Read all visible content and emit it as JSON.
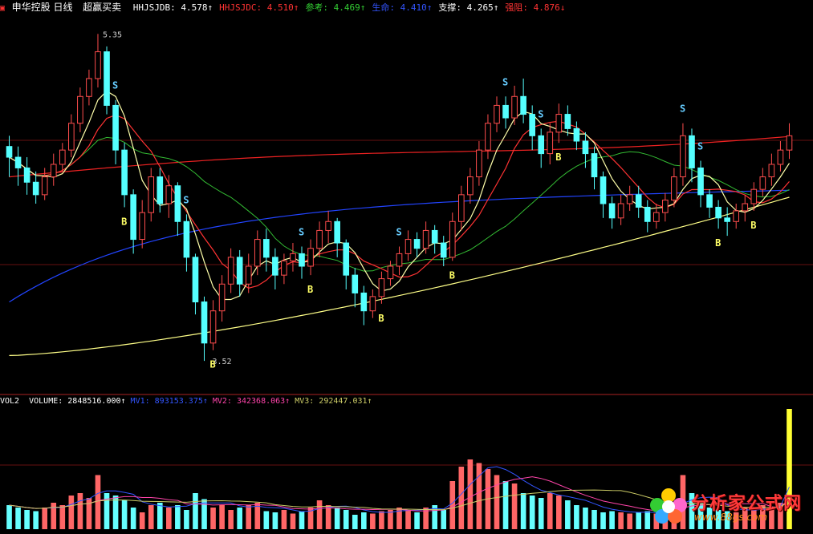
{
  "header": {
    "title": "申华控股 日线",
    "indicator_name": "超赢买卖",
    "items": [
      {
        "label": "HHJSJDB",
        "value": "4.578",
        "arrow": "↑",
        "color": "#ffffff"
      },
      {
        "label": "HHJSJDC",
        "value": "4.510",
        "arrow": "↑",
        "color": "#ff3333"
      },
      {
        "label": "参考",
        "value": "4.469",
        "arrow": "↑",
        "color": "#33cc33"
      },
      {
        "label": "生命",
        "value": "4.410",
        "arrow": "↑",
        "color": "#3355ff"
      },
      {
        "label": "支撑",
        "value": "4.265",
        "arrow": "↑",
        "color": "#ffffff"
      },
      {
        "label": "强阻",
        "value": "4.876",
        "arrow": "↓",
        "color": "#ff3333"
      }
    ]
  },
  "volume_header": {
    "name": "VOL2",
    "items": [
      {
        "label": "VOLUME",
        "value": "2848516.000",
        "arrow": "↑",
        "color": "#ffffff"
      },
      {
        "label": "MV1",
        "value": "893153.375",
        "arrow": "↑",
        "color": "#3355ff"
      },
      {
        "label": "MV2",
        "value": "342368.063",
        "arrow": "↑",
        "color": "#ff44aa"
      },
      {
        "label": "MV3",
        "value": "292447.031",
        "arrow": "↑",
        "color": "#cccc66"
      }
    ]
  },
  "chart_data": {
    "type": "candlestick",
    "price_labels": {
      "high": "5.35",
      "low": "3.52"
    },
    "signal_labels": {
      "buy": "B",
      "sell": "S"
    },
    "series_colors": {
      "up": "#ff4d4d",
      "down": "#55ffff",
      "ma_short": "#ffffaa",
      "ma_mid": "#ff3333",
      "ma_green": "#33bb33",
      "ma_blue": "#2244ff",
      "ma_yellow": "#ffff88",
      "ma_red_long": "#ee2222"
    },
    "legend_watermark": {
      "text": "分析家公式网",
      "url": "www.88gs.com"
    },
    "candles": [
      [
        4.72,
        4.66,
        4.78,
        4.55
      ],
      [
        4.66,
        4.6,
        4.72,
        4.5
      ],
      [
        4.6,
        4.52,
        4.66,
        4.45
      ],
      [
        4.52,
        4.45,
        4.58,
        4.4
      ],
      [
        4.45,
        4.55,
        4.6,
        4.42
      ],
      [
        4.55,
        4.62,
        4.68,
        4.5
      ],
      [
        4.62,
        4.7,
        4.74,
        4.58
      ],
      [
        4.7,
        4.85,
        4.9,
        4.66
      ],
      [
        4.85,
        5.0,
        5.05,
        4.8
      ],
      [
        5.0,
        5.1,
        5.15,
        4.95
      ],
      [
        5.1,
        5.25,
        5.35,
        5.05
      ],
      [
        5.25,
        4.95,
        5.28,
        4.9
      ],
      [
        4.95,
        4.7,
        4.98,
        4.62
      ],
      [
        4.7,
        4.45,
        4.74,
        4.38
      ],
      [
        4.45,
        4.2,
        4.48,
        4.12
      ],
      [
        4.2,
        4.35,
        4.42,
        4.15
      ],
      [
        4.35,
        4.55,
        4.6,
        4.3
      ],
      [
        4.55,
        4.4,
        4.6,
        4.35
      ],
      [
        4.4,
        4.5,
        4.56,
        4.32
      ],
      [
        4.5,
        4.3,
        4.52,
        4.22
      ],
      [
        4.3,
        4.1,
        4.34,
        4.02
      ],
      [
        4.1,
        3.85,
        4.12,
        3.78
      ],
      [
        3.85,
        3.62,
        3.88,
        3.52
      ],
      [
        3.62,
        3.8,
        3.86,
        3.58
      ],
      [
        3.8,
        3.95,
        4.0,
        3.74
      ],
      [
        3.95,
        4.1,
        4.15,
        3.9
      ],
      [
        4.1,
        3.95,
        4.14,
        3.88
      ],
      [
        3.95,
        4.05,
        4.12,
        3.9
      ],
      [
        4.05,
        4.2,
        4.25,
        4.0
      ],
      [
        4.2,
        4.1,
        4.26,
        4.02
      ],
      [
        4.1,
        4.0,
        4.15,
        3.92
      ],
      [
        4.0,
        4.08,
        4.12,
        3.95
      ],
      [
        4.08,
        4.12,
        4.18,
        4.02
      ],
      [
        4.12,
        4.05,
        4.16,
        3.98
      ],
      [
        4.05,
        4.15,
        4.2,
        4.0
      ],
      [
        4.15,
        4.25,
        4.3,
        4.1
      ],
      [
        4.25,
        4.3,
        4.36,
        4.18
      ],
      [
        4.3,
        4.18,
        4.32,
        4.1
      ],
      [
        4.18,
        4.0,
        4.2,
        3.92
      ],
      [
        4.0,
        3.9,
        4.04,
        3.82
      ],
      [
        3.9,
        3.8,
        3.94,
        3.72
      ],
      [
        3.8,
        3.88,
        3.92,
        3.76
      ],
      [
        3.88,
        3.98,
        4.02,
        3.84
      ],
      [
        3.98,
        4.05,
        4.08,
        3.94
      ],
      [
        4.05,
        4.12,
        4.16,
        4.0
      ],
      [
        4.12,
        4.2,
        4.25,
        4.08
      ],
      [
        4.2,
        4.15,
        4.24,
        4.1
      ],
      [
        4.15,
        4.25,
        4.3,
        4.12
      ],
      [
        4.25,
        4.18,
        4.28,
        4.12
      ],
      [
        4.18,
        4.1,
        4.22,
        4.05
      ],
      [
        4.1,
        4.3,
        4.35,
        4.08
      ],
      [
        4.3,
        4.45,
        4.5,
        4.25
      ],
      [
        4.45,
        4.55,
        4.6,
        4.4
      ],
      [
        4.55,
        4.7,
        4.75,
        4.5
      ],
      [
        4.7,
        4.85,
        4.9,
        4.65
      ],
      [
        4.85,
        4.95,
        5.0,
        4.8
      ],
      [
        4.95,
        4.88,
        5.0,
        4.82
      ],
      [
        4.88,
        5.0,
        5.06,
        4.84
      ],
      [
        5.0,
        4.9,
        5.1,
        4.85
      ],
      [
        4.9,
        4.78,
        4.95,
        4.7
      ],
      [
        4.78,
        4.68,
        4.82,
        4.6
      ],
      [
        4.68,
        4.8,
        4.85,
        4.62
      ],
      [
        4.8,
        4.9,
        4.96,
        4.74
      ],
      [
        4.9,
        4.82,
        4.95,
        4.78
      ],
      [
        4.82,
        4.75,
        4.86,
        4.7
      ],
      [
        4.75,
        4.68,
        4.8,
        4.6
      ],
      [
        4.68,
        4.55,
        4.72,
        4.48
      ],
      [
        4.55,
        4.4,
        4.58,
        4.32
      ],
      [
        4.4,
        4.32,
        4.44,
        4.26
      ],
      [
        4.32,
        4.4,
        4.45,
        4.28
      ],
      [
        4.4,
        4.45,
        4.5,
        4.36
      ],
      [
        4.45,
        4.38,
        4.5,
        4.32
      ],
      [
        4.38,
        4.3,
        4.42,
        4.24
      ],
      [
        4.3,
        4.35,
        4.4,
        4.26
      ],
      [
        4.35,
        4.42,
        4.46,
        4.3
      ],
      [
        4.42,
        4.55,
        4.6,
        4.38
      ],
      [
        4.55,
        4.78,
        4.85,
        4.5
      ],
      [
        4.78,
        4.6,
        4.82,
        4.52
      ],
      [
        4.6,
        4.45,
        4.64,
        4.38
      ],
      [
        4.45,
        4.38,
        4.48,
        4.32
      ],
      [
        4.38,
        4.32,
        4.42,
        4.26
      ],
      [
        4.32,
        4.3,
        4.38,
        4.22
      ],
      [
        4.3,
        4.36,
        4.4,
        4.26
      ],
      [
        4.36,
        4.4,
        4.45,
        4.3
      ],
      [
        4.4,
        4.48,
        4.52,
        4.36
      ],
      [
        4.48,
        4.55,
        4.6,
        4.44
      ],
      [
        4.55,
        4.62,
        4.68,
        4.5
      ],
      [
        4.62,
        4.7,
        4.75,
        4.58
      ],
      [
        4.7,
        4.78,
        4.85,
        4.65
      ]
    ],
    "volume": [
      0.2,
      0.18,
      0.16,
      0.15,
      0.18,
      0.22,
      0.2,
      0.28,
      0.3,
      0.26,
      0.45,
      0.3,
      0.28,
      0.24,
      0.18,
      0.14,
      0.2,
      0.22,
      0.18,
      0.2,
      0.16,
      0.3,
      0.25,
      0.18,
      0.2,
      0.16,
      0.18,
      0.2,
      0.22,
      0.15,
      0.14,
      0.16,
      0.13,
      0.15,
      0.18,
      0.24,
      0.2,
      0.18,
      0.16,
      0.12,
      0.14,
      0.13,
      0.15,
      0.16,
      0.18,
      0.16,
      0.14,
      0.18,
      0.2,
      0.16,
      0.4,
      0.52,
      0.58,
      0.55,
      0.5,
      0.45,
      0.4,
      0.38,
      0.3,
      0.28,
      0.26,
      0.3,
      0.28,
      0.24,
      0.2,
      0.18,
      0.16,
      0.14,
      0.15,
      0.14,
      0.13,
      0.14,
      0.15,
      0.13,
      0.16,
      0.18,
      0.45,
      0.3,
      0.22,
      0.18,
      0.16,
      0.15,
      0.14,
      0.18,
      0.16,
      0.2,
      0.18,
      0.22,
      1.0
    ]
  }
}
